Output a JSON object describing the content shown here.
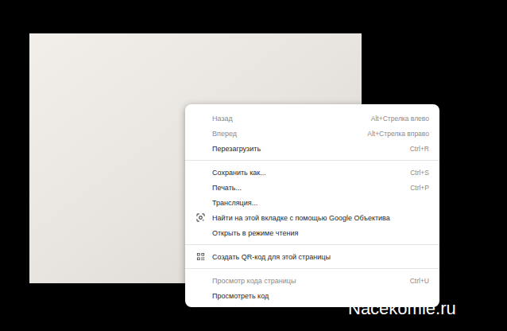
{
  "menu": {
    "groups": [
      [
        {
          "label": "Назад",
          "shortcut": "Alt+Стрелка влево",
          "disabled": true,
          "kind": "plain"
        },
        {
          "label": "Вперед",
          "shortcut": "Alt+Стрелка вправо",
          "disabled": true,
          "kind": "plain"
        },
        {
          "label": "Перезагрузить",
          "shortcut": "Ctrl+R",
          "disabled": false,
          "kind": "plain"
        }
      ],
      [
        {
          "label": "Сохранить как...",
          "shortcut": "Ctrl+S",
          "disabled": false,
          "kind": "plain"
        },
        {
          "label": "Печать...",
          "shortcut": "Ctrl+P",
          "disabled": false,
          "kind": "plain"
        },
        {
          "label": "Трансляция...",
          "shortcut": "",
          "disabled": false,
          "kind": "plain"
        },
        {
          "label": "Найти на этой вкладке с помощью Google Объектива",
          "shortcut": "",
          "disabled": false,
          "kind": "lens"
        },
        {
          "label": "Открыть в режиме чтения",
          "shortcut": "",
          "disabled": false,
          "kind": "plain"
        }
      ],
      [
        {
          "label": "Создать QR-код для этой страницы",
          "shortcut": "",
          "disabled": false,
          "kind": "qr"
        }
      ],
      [
        {
          "label": "Просмотр кода страницы",
          "shortcut": "Ctrl+U",
          "disabled": true,
          "kind": "plain"
        },
        {
          "label": "Просмотреть код",
          "shortcut": "",
          "disabled": false,
          "kind": "plain"
        }
      ]
    ]
  },
  "watermark": "Nacekomie.ru"
}
